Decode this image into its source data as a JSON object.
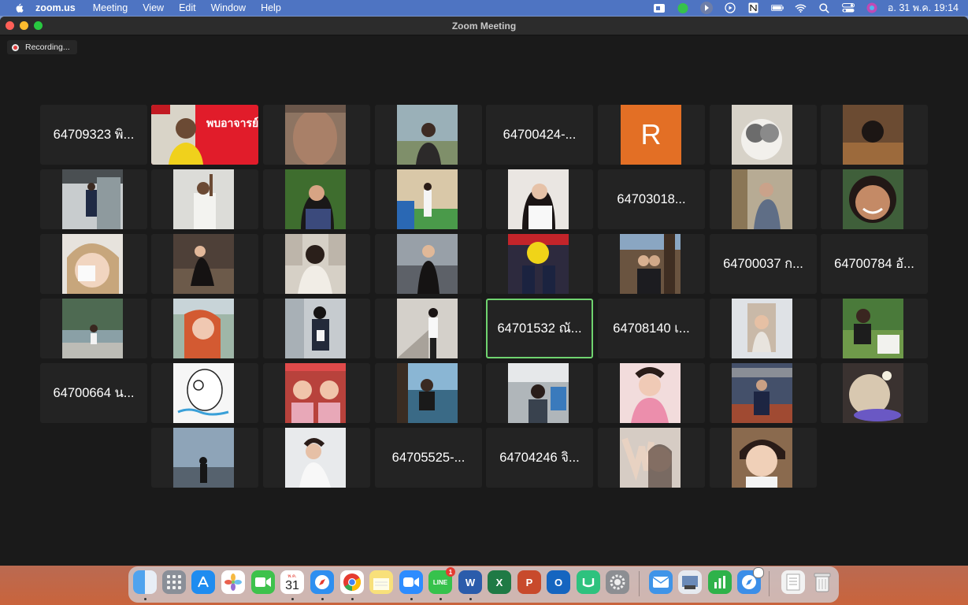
{
  "menubar": {
    "app_name": "zoom.us",
    "items": [
      "Meeting",
      "View",
      "Edit",
      "Window",
      "Help"
    ],
    "clock": "อ. 31 พ.ค. 19:14"
  },
  "window": {
    "title": "Zoom Meeting",
    "recording_label": "Recording..."
  },
  "participants": {
    "name_tiles": [
      "64709323 พิ...",
      "64700424-...",
      "64703018...",
      "64700037 ก...",
      "64700784 อั...",
      "64701532 ณั...",
      "64708140 เ...",
      "64700664 น...",
      "64705525-...",
      "64704246 จิ..."
    ],
    "avatar_letter": "R",
    "banner_text": "พบอาจารย์ที่ปรึกษา",
    "badge_count": "1"
  },
  "dock": {
    "calendar_day": "31",
    "calendar_month": "พ.ค.",
    "line_label": "LINE",
    "line_badge": "1",
    "word_label": "W",
    "excel_label": "X",
    "powerpoint_label": "P",
    "outlook_label": "O"
  }
}
